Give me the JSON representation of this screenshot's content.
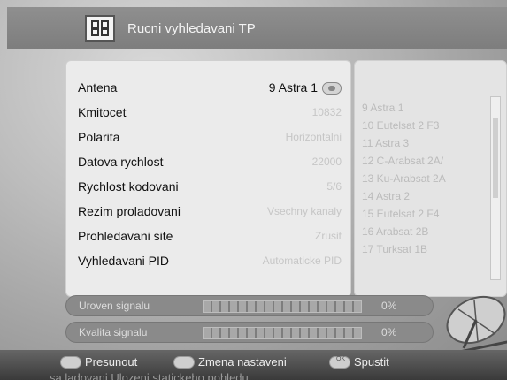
{
  "header": {
    "title": "Rucni vyhledavani TP",
    "icon": "satellite-menu-icon"
  },
  "settings": [
    {
      "label": "Antena",
      "value": "9 Astra 1",
      "active": true
    },
    {
      "label": "Kmitocet",
      "value": "10832"
    },
    {
      "label": "Polarita",
      "value": "Horizontalni"
    },
    {
      "label": "Datova rychlost",
      "value": "22000"
    },
    {
      "label": "Rychlost kodovani",
      "value": "5/6"
    },
    {
      "label": "Rezim proladovani",
      "value": "Vsechny kanaly"
    },
    {
      "label": "Prohledavani site",
      "value": "Zrusit"
    },
    {
      "label": "Vyhledavani PID",
      "value": "Automaticke PID"
    }
  ],
  "satellites": [
    "9 Astra 1",
    "10 Eutelsat 2 F3",
    "11 Astra 3",
    "12 C-Arabsat 2A/",
    "13 Ku-Arabsat 2A",
    "14 Astra 2",
    "15 Eutelsat 2 F4",
    "16 Arabsat 2B",
    "17 Turksat 1B"
  ],
  "meters": {
    "signal_level": {
      "label": "Uroven signalu",
      "value": "0%"
    },
    "signal_quality": {
      "label": "Kvalita signalu",
      "value": "0%"
    }
  },
  "footer": {
    "move_label": "Presunout",
    "change_label": "Zmena nastaveni",
    "start_label": "Spustit",
    "ok_key": "OK",
    "line2": "sa ladovani       Ulozeni statickeho pohledu"
  }
}
